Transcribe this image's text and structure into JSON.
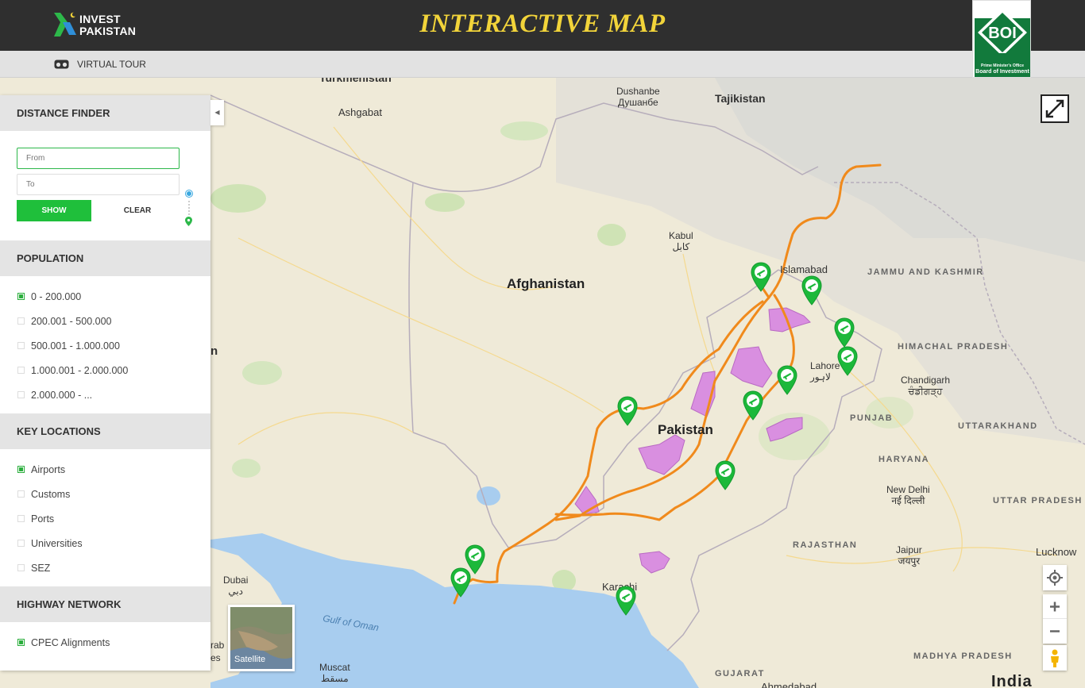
{
  "header": {
    "logo_line1": "INVEST",
    "logo_line2": "PAKISTAN",
    "title": "INTERACTIVE MAP",
    "boi_badge": "BOI",
    "boi_sub1": "Prime Minister's Office",
    "boi_sub2": "Board of Investment"
  },
  "subbar": {
    "virtual_tour_label": "VIRTUAL TOUR",
    "icon": "vr-headset-icon"
  },
  "distance_finder": {
    "heading": "DISTANCE FINDER",
    "from_placeholder": "From",
    "to_placeholder": "To",
    "show_label": "SHOW",
    "clear_label": "CLEAR"
  },
  "population": {
    "heading": "POPULATION",
    "items": [
      {
        "label": "0 - 200.000",
        "checked": true
      },
      {
        "label": "200.001 - 500.000",
        "checked": false
      },
      {
        "label": "500.001 - 1.000.000",
        "checked": false
      },
      {
        "label": "1.000.001 - 2.000.000",
        "checked": false
      },
      {
        "label": "2.000.000 - ...",
        "checked": false
      }
    ]
  },
  "key_locations": {
    "heading": "KEY LOCATIONS",
    "items": [
      {
        "label": "Airports",
        "checked": true
      },
      {
        "label": "Customs",
        "checked": false
      },
      {
        "label": "Ports",
        "checked": false
      },
      {
        "label": "Universities",
        "checked": false
      },
      {
        "label": "SEZ",
        "checked": false
      }
    ]
  },
  "highway_network": {
    "heading": "HIGHWAY NETWORK",
    "items": [
      {
        "label": "CPEC Alignments",
        "checked": true
      }
    ]
  },
  "map": {
    "satellite_label": "Satellite",
    "labels": {
      "turkmenistan": "Turkmenistan",
      "ashgabat": "Ashgabat",
      "dushanbe": "Dushanbe",
      "dushanbe_local": "Душанбе",
      "tajikistan": "Tajikistan",
      "kabul": "Kabul",
      "kabul_local": "کابل",
      "afghanistan": "Afghanistan",
      "islamabad": "Islamabad",
      "jammu_kashmir": "JAMMU AND KASHMIR",
      "himachal_pradesh": "HIMACHAL PRADESH",
      "lahore": "Lahore",
      "lahore_local": "لاہور",
      "chandigarh": "Chandigarh",
      "chandigarh_local": "ਚੰਡੀਗੜ੍ਹ",
      "punjab": "PUNJAB",
      "uttarakhand": "UTTARAKHAND",
      "pakistan": "Pakistan",
      "haryana": "HARYANA",
      "new_delhi": "New Delhi",
      "new_delhi_local": "नई दिल्ली",
      "uttar_pradesh": "UTTAR PRADESH",
      "rajasthan": "RAJASTHAN",
      "jaipur": "Jaipur",
      "jaipur_local": "जयपुर",
      "lucknow": "Lucknow",
      "dubai": "Dubai",
      "dubai_local": "دبي",
      "gulf_of_oman": "Gulf of Oman",
      "karachi": "Karachi",
      "muscat": "Muscat",
      "muscat_local": "مسقط",
      "madhya_pradesh": "MADHYA PRADESH",
      "gujarat": "GUJARAT",
      "ahmedabad": "Ahmedabad",
      "india": "India",
      "arab_partial": "rab",
      "es_partial": "es",
      "n_partial": "n"
    },
    "airport_icon": "airport-marker-icon",
    "colors": {
      "cpec_route": "#f08a1c",
      "special_zone": "#d98fe0",
      "airport_marker": "#1cb83a",
      "water": "#a8cdef",
      "land": "#efead8"
    }
  }
}
